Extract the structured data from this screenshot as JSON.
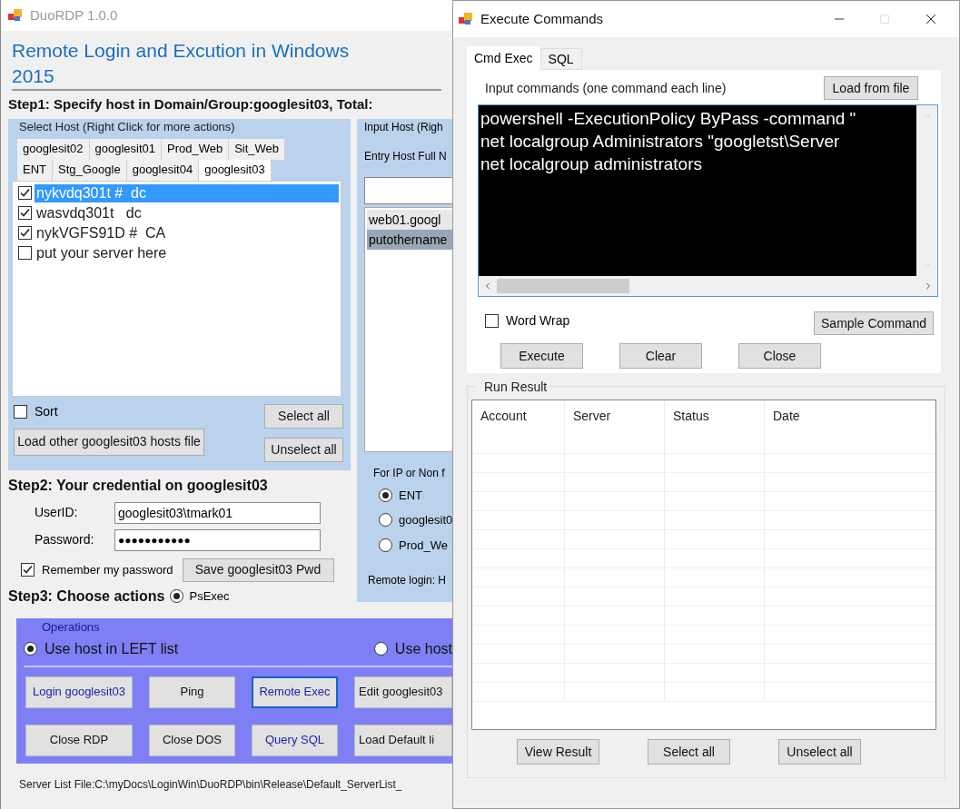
{
  "main_window": {
    "title": "DuoRDP 1.0.0",
    "heading": "Remote Login and Excution in Windows",
    "year": "2015",
    "step1": "Step1: Specify host in Domain/Group:googlesit03, Total:",
    "select_host": {
      "caption": "Select Host (Right Click for more actions)",
      "tab_rows": [
        {
          "tabs": [
            {
              "label": "googlesit02",
              "selected": false
            },
            {
              "label": "googlesit01",
              "selected": false
            },
            {
              "label": "Prod_Web",
              "selected": false
            },
            {
              "label": "Sit_Web",
              "selected": false
            }
          ]
        },
        {
          "tabs": [
            {
              "label": "ENT",
              "selected": false
            },
            {
              "label": "Stg_Google",
              "selected": false
            },
            {
              "label": "googlesit04",
              "selected": false
            },
            {
              "label": "googlesit03",
              "selected": true
            }
          ]
        }
      ],
      "hosts": [
        {
          "label": "nykvdq301t #  dc",
          "checked": true,
          "selected": true
        },
        {
          "label": "wasvdq301t   dc",
          "checked": true,
          "selected": false
        },
        {
          "label": "nykVGFS91D #  CA",
          "checked": true,
          "selected": false
        },
        {
          "label": "put your server here",
          "checked": false,
          "selected": false
        }
      ],
      "sort": {
        "label": "Sort",
        "checked": false
      },
      "load_button": "Load other googlesit03 hosts file",
      "select_all": "Select all",
      "unselect_all": "Unselect all"
    },
    "input_host": {
      "caption": "Input Host (Righ",
      "entry_label": "Entry Host Full N",
      "hosts": [
        {
          "label": "web01.googl",
          "selected": false
        },
        {
          "label": "putothername",
          "selected": true
        }
      ],
      "option_caption": "For IP or Non f",
      "options": [
        {
          "label": "ENT",
          "selected": true
        },
        {
          "label": "googlesit0",
          "selected": false
        },
        {
          "label": "Prod_We",
          "selected": false
        }
      ],
      "remote_login": "Remote login: H"
    },
    "step2": "Step2: Your credential on googlesit03",
    "userid": {
      "label": "UserID:",
      "value": "googlesit03\\tmark01"
    },
    "password": {
      "label": "Password:",
      "value": "●●●●●●●●●●●"
    },
    "remember": {
      "label": "Remember my password",
      "checked": true
    },
    "save_button": "Save googlesit03 Pwd",
    "step3": "Step3: Choose actions",
    "psexec": {
      "label": "PsExec",
      "selected": true
    },
    "operations": {
      "caption": "Operations",
      "sources": [
        {
          "label": "Use host in LEFT list",
          "selected": true
        },
        {
          "label": "Use host",
          "selected": false
        }
      ],
      "buttons": [
        {
          "label": "Login googlesit03",
          "link": true,
          "focused": false
        },
        {
          "label": "Ping",
          "link": false,
          "focused": false
        },
        {
          "label": "Remote Exec",
          "link": true,
          "focused": true
        },
        {
          "label": "Edit googlesit03",
          "link": false,
          "focused": false
        },
        {
          "label": "Close RDP",
          "link": false,
          "focused": false
        },
        {
          "label": "Close DOS",
          "link": false,
          "focused": false
        },
        {
          "label": "Query SQL",
          "link": true,
          "focused": false
        },
        {
          "label": "Load Default li",
          "link": false,
          "focused": false
        }
      ]
    },
    "status": "Server List File:C:\\myDocs\\LoginWin\\DuoRDP\\bin\\Release\\Default_ServerList_"
  },
  "exec_window": {
    "title": "Execute Commands",
    "tabs": [
      {
        "label": "Cmd Exec",
        "selected": true
      },
      {
        "label": "SQL",
        "selected": false
      }
    ],
    "input_label": "Input commands (one command each line)",
    "load_button": "Load from file",
    "commands": [
      "powershell -ExecutionPolicy ByPass -command \"",
      "net localgroup Administrators \"googletst\\Server",
      "net localgroup administrators"
    ],
    "word_wrap": {
      "label": "Word Wrap",
      "checked": false
    },
    "sample_button": "Sample Command",
    "actions": [
      "Execute",
      "Clear",
      "Close"
    ],
    "result": {
      "caption": "Run Result",
      "columns": [
        "Account",
        "Server",
        "Status",
        "Date"
      ]
    },
    "result_buttons": [
      "View Result",
      "Select all",
      "Unselect all"
    ]
  }
}
